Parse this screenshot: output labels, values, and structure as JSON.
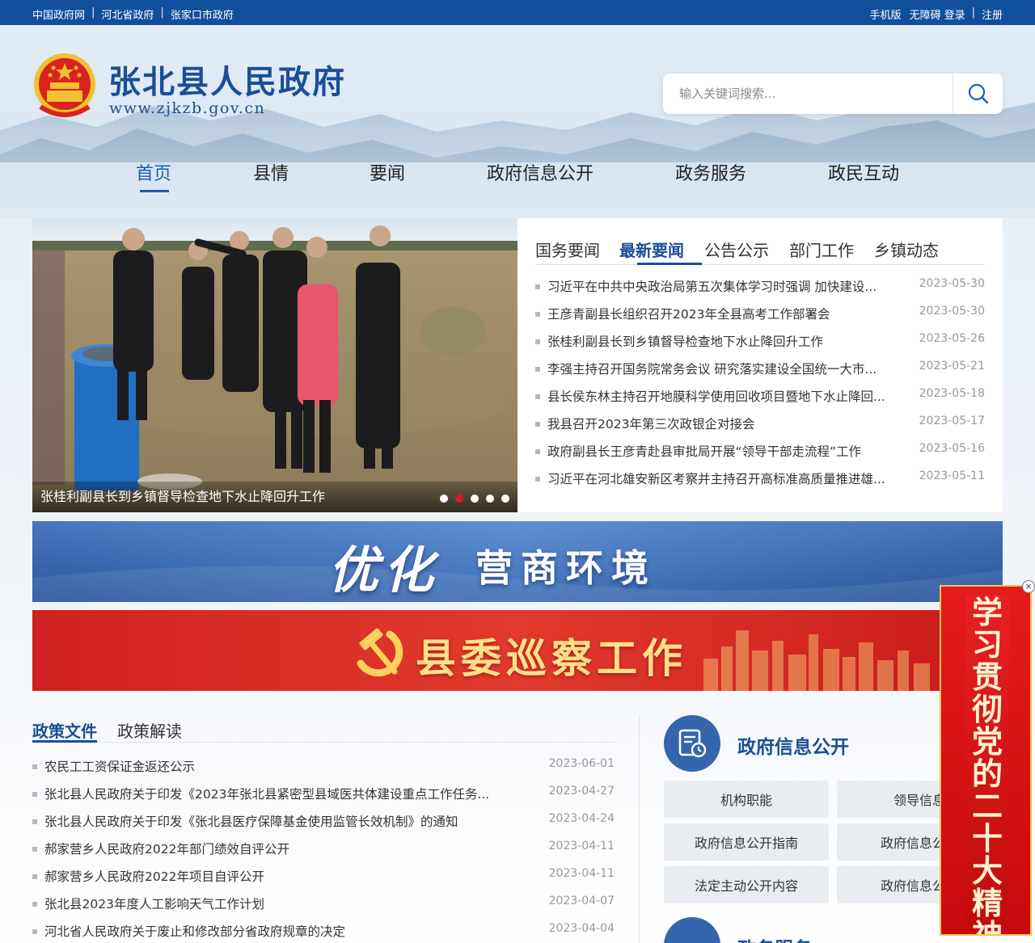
{
  "topbar": {
    "links": [
      "中国政府网",
      "河北省政府",
      "张家口市政府"
    ],
    "right": {
      "mobile": "手机版",
      "accessible": "无障碍",
      "login": "登录",
      "register": "注册"
    }
  },
  "header": {
    "title": "张北县人民政府",
    "url": "www.zjkzb.gov.cn",
    "search_placeholder": "输入关键词搜索..."
  },
  "nav": {
    "items": [
      "首页",
      "县情",
      "要闻",
      "政府信息公开",
      "政务服务",
      "政民互动"
    ],
    "active": 0
  },
  "slider": {
    "caption": "张桂利副县长到乡镇督导检查地下水止降回升工作",
    "dots": 5,
    "active_dot": 1
  },
  "news": {
    "tabs": [
      "国务要闻",
      "最新要闻",
      "公告公示",
      "部门工作",
      "乡镇动态"
    ],
    "active_tab": 1,
    "items": [
      {
        "title": "习近平在中共中央政治局第五次集体学习时强调 加快建设...",
        "date": "2023-05-30"
      },
      {
        "title": "王彦青副县长组织召开2023年全县高考工作部署会",
        "date": "2023-05-30"
      },
      {
        "title": "张桂利副县长到乡镇督导检查地下水止降回升工作",
        "date": "2023-05-26"
      },
      {
        "title": "李强主持召开国务院常务会议 研究落实建设全国统一大市...",
        "date": "2023-05-21"
      },
      {
        "title": "县长侯东林主持召开地膜科学使用回收项目暨地下水止降回...",
        "date": "2023-05-18"
      },
      {
        "title": "我县召开2023年第三次政银企对接会",
        "date": "2023-05-17"
      },
      {
        "title": "政府副县长王彦青赴县审批局开展“领导干部走流程”工作",
        "date": "2023-05-16"
      },
      {
        "title": "习近平在河北雄安新区考察并主持召开高标准高质量推进雄...",
        "date": "2023-05-11"
      }
    ]
  },
  "banners": {
    "banner1": {
      "bold": "优化",
      "rest": "营商环境",
      "color": "#3a6fc0"
    },
    "banner2": {
      "text": "县委巡察工作",
      "color": "#d42a2a"
    }
  },
  "policy": {
    "tabs": [
      "政策文件",
      "政策解读"
    ],
    "active_tab": 0,
    "items": [
      {
        "title": "农民工工资保证金返还公示",
        "date": "2023-06-01"
      },
      {
        "title": "张北县人民政府关于印发《2023年张北县紧密型县域医共体建设重点工作任务...",
        "date": "2023-04-27"
      },
      {
        "title": "张北县人民政府关于印发《张北县医疗保障基金使用监管长效机制》的通知",
        "date": "2023-04-24"
      },
      {
        "title": "郝家营乡人民政府2022年部门绩效自评公开",
        "date": "2023-04-11"
      },
      {
        "title": "郝家营乡人民政府2022年项目自评公开",
        "date": "2023-04-11"
      },
      {
        "title": "张北县2023年度人工影响天气工作计划",
        "date": "2023-04-07"
      },
      {
        "title": "河北省人民政府关于废止和修改部分省政府规章的决定",
        "date": "2023-04-04"
      }
    ]
  },
  "gov_open": {
    "heading": "政府信息公开",
    "cells": [
      "机构职能",
      "领导信息",
      "政府信息公开指南",
      "政府信息公开",
      "法定主动公开内容",
      "政府信息公开"
    ],
    "heading2": "政务服务"
  },
  "float_banner": {
    "text": "学习贯彻党的二十大精神",
    "close": "×"
  }
}
